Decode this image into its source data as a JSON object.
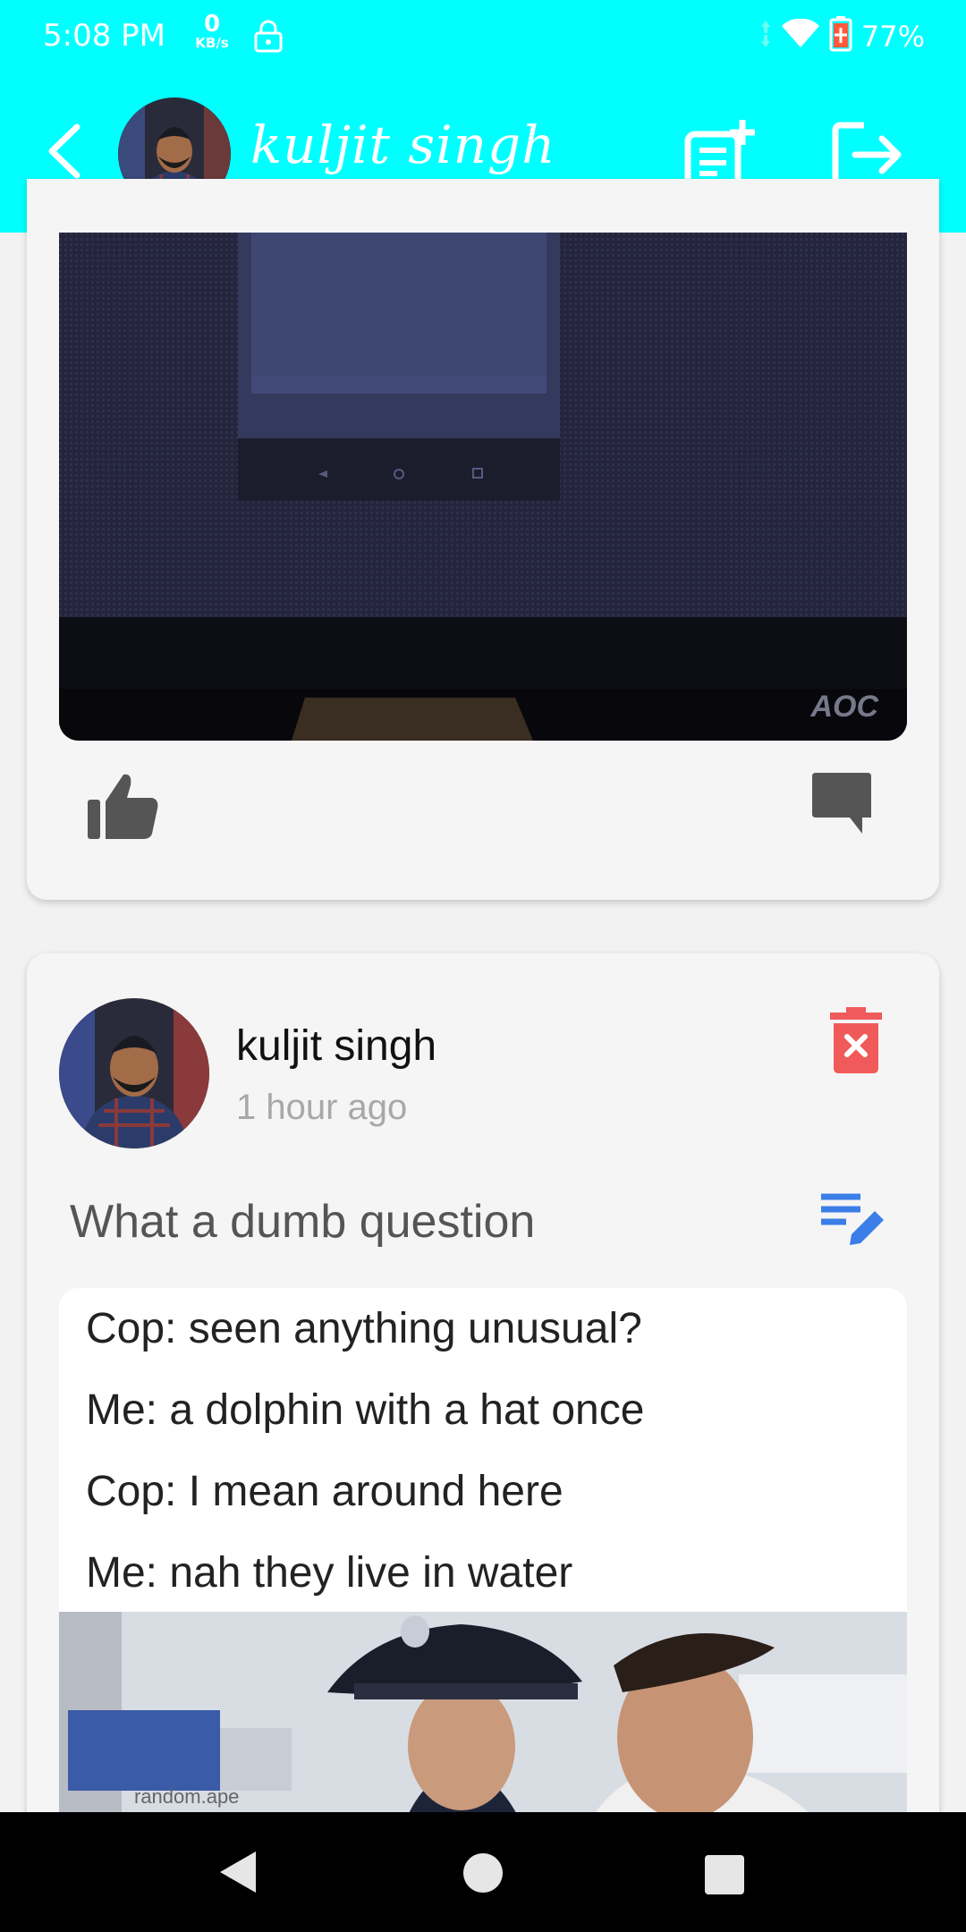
{
  "status_bar": {
    "time": "5:08 PM",
    "net_speed_value": "0",
    "net_speed_unit": "KB/s",
    "battery": "77%"
  },
  "header": {
    "title": "kuljit singh",
    "icons": [
      "back-arrow-icon",
      "avatar",
      "new-post-icon",
      "logout-icon"
    ]
  },
  "posts": [
    {
      "image_label": "AOC",
      "actions": [
        "like-icon",
        "comment-icon"
      ]
    },
    {
      "author": "kuljit singh",
      "time": "1 hour ago",
      "caption": "What a dumb question",
      "meme_lines": [
        "Cop: seen anything unusual?",
        "Me: a dolphin with a hat once",
        "Cop: I mean around here",
        "Me: nah they live in water"
      ],
      "watermark": "random.ape"
    }
  ],
  "colors": {
    "accent": "#00ffff",
    "delete": "#f05a5a",
    "edit": "#3b7ee8",
    "action_icon": "#555555"
  }
}
